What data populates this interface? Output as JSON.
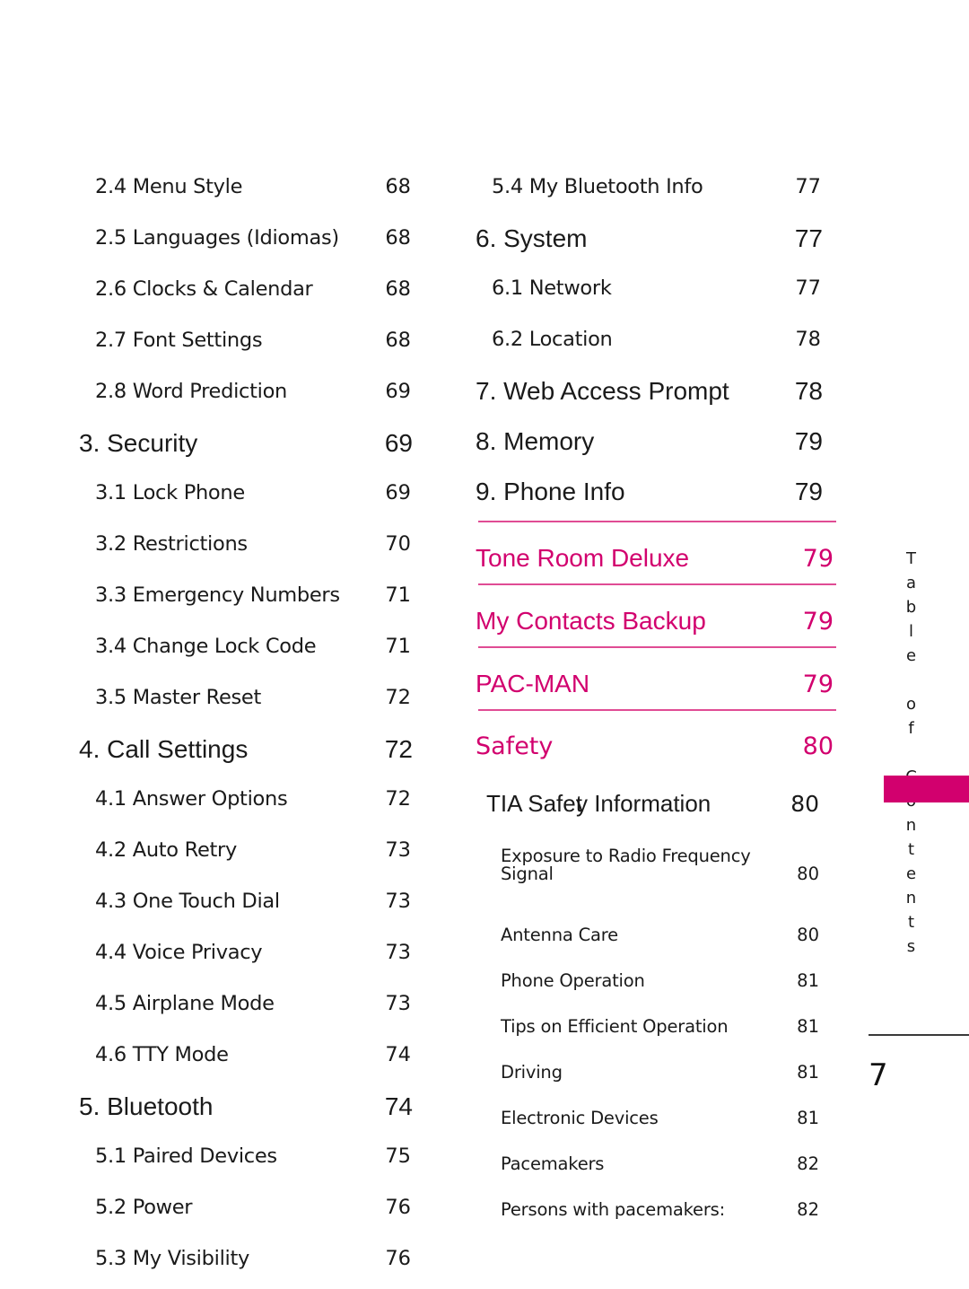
{
  "page": {
    "folio": "7",
    "side_tab_label": "Table of Contents",
    "accent_color": "#D2006E",
    "rule_color": "#E04C94"
  },
  "left_column": [
    {
      "level": 2,
      "label": "2.4 Menu Style",
      "page": "68"
    },
    {
      "level": 2,
      "label": "2.5 Languages (Idiomas)",
      "page": "68"
    },
    {
      "level": 2,
      "label": "2.6 Clocks & Calendar",
      "page": "68"
    },
    {
      "level": 2,
      "label": "2.7 Font Settings",
      "page": "68"
    },
    {
      "level": 2,
      "label": "2.8 Word Prediction",
      "page": "69"
    },
    {
      "level": 1,
      "label": "3. Security",
      "page": "69"
    },
    {
      "level": 2,
      "label": "3.1 Lock Phone",
      "page": "69"
    },
    {
      "level": 2,
      "label": "3.2 Restrictions",
      "page": "70"
    },
    {
      "level": 2,
      "label": "3.3 Emergency Numbers",
      "page": "71"
    },
    {
      "level": 2,
      "label": "3.4 Change Lock Code",
      "page": "71"
    },
    {
      "level": 2,
      "label": "3.5 Master Reset",
      "page": "72"
    },
    {
      "level": 1,
      "label": "4. Call Settings",
      "page": "72"
    },
    {
      "level": 2,
      "label": "4.1 Answer Options",
      "page": "72"
    },
    {
      "level": 2,
      "label": "4.2 Auto Retry",
      "page": "73"
    },
    {
      "level": 2,
      "label": "4.3 One Touch Dial",
      "page": "73"
    },
    {
      "level": 2,
      "label": "4.4 Voice Privacy",
      "page": "73"
    },
    {
      "level": 2,
      "label": "4.5 Airplane Mode",
      "page": "73"
    },
    {
      "level": 2,
      "label": "4.6 TTY Mode",
      "page": "74"
    },
    {
      "level": 1,
      "label": "5. Bluetooth",
      "page": "74"
    },
    {
      "level": 2,
      "label": "5.1 Paired Devices",
      "page": "75"
    },
    {
      "level": 2,
      "label": "5.2 Power",
      "page": "76"
    },
    {
      "level": 2,
      "label": "5.3 My Visibility",
      "page": "76"
    }
  ],
  "right_column_top": [
    {
      "level": 2,
      "label": "5.4 My Bluetooth Info",
      "page": "77"
    },
    {
      "level": 1,
      "label": "6. System",
      "page": "77"
    },
    {
      "level": 2,
      "label": "6.1 Network",
      "page": "77"
    },
    {
      "level": 2,
      "label": "6.2 Location",
      "page": "78"
    },
    {
      "level": 1,
      "label": "7. Web Access Prompt",
      "page": "78"
    },
    {
      "level": 1,
      "label": "8. Memory",
      "page": "79"
    },
    {
      "level": 1,
      "label": "9. Phone Info",
      "page": "79"
    }
  ],
  "featured": [
    {
      "label": "Tone Room Deluxe",
      "page": "79",
      "style": "sans"
    },
    {
      "label": "My Contacts Backup",
      "page": "79",
      "style": "sans"
    },
    {
      "label": "PAC-MAN",
      "page": "79",
      "style": "sans"
    },
    {
      "label": "Safety",
      "page": "80",
      "style": "serifish"
    }
  ],
  "tia": {
    "label_a": "TIA Safe",
    "label_kern": "t",
    "label_b": "y Information",
    "page": "80"
  },
  "safety_items": [
    {
      "label": "Exposure to Radio Frequency",
      "label2": "Signal",
      "page": "80",
      "wrapped": true
    },
    {
      "label": "Antenna Care",
      "page": "80"
    },
    {
      "label": "Phone Operation",
      "page": "81"
    },
    {
      "label": "Tips on Efficient Operation",
      "page": "81"
    },
    {
      "label": "Driving",
      "page": "81"
    },
    {
      "label": "Electronic Devices",
      "page": "81"
    },
    {
      "label": "Pacemakers",
      "page": "82"
    },
    {
      "label": "Persons with pacemakers:",
      "page": "82"
    }
  ]
}
